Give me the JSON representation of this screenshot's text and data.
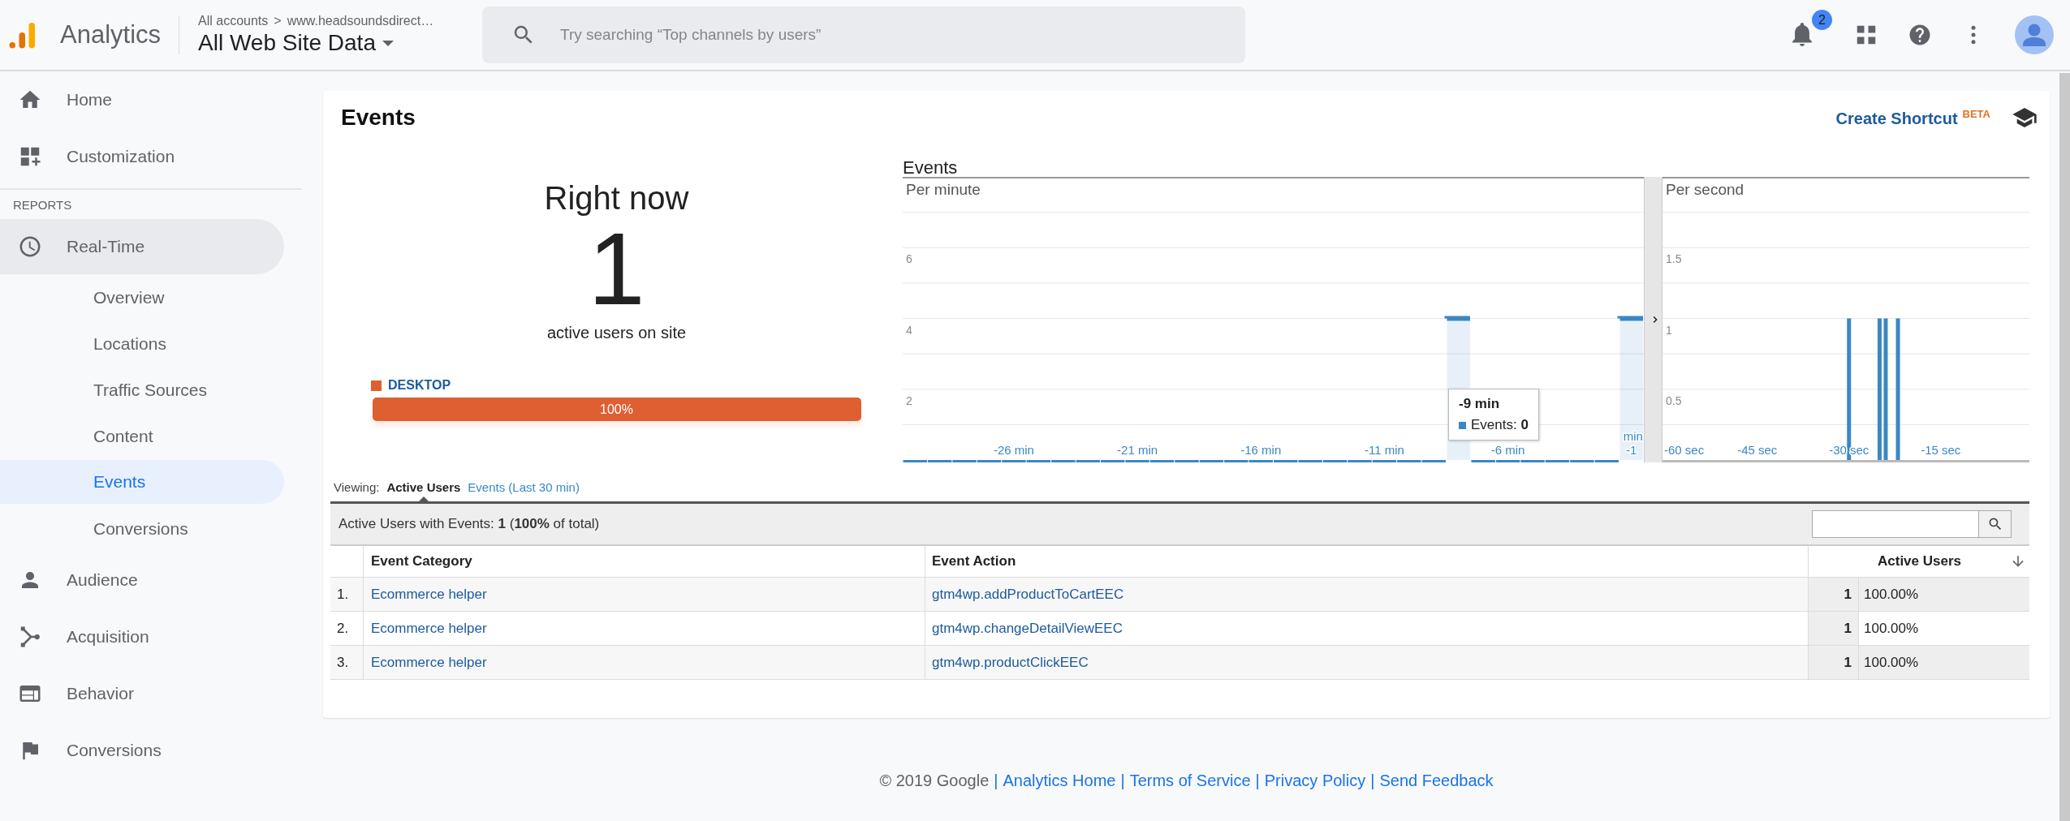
{
  "header": {
    "app_name": "Analytics",
    "breadcrumb": {
      "account": "All accounts",
      "separator": ">",
      "property": "www.headsoundsdirect…"
    },
    "view": "All Web Site Data",
    "search": {
      "placeholder": "Try searching “Top channels by users”"
    },
    "notification_count": "2"
  },
  "sidebar": {
    "items": [
      {
        "label": "Home",
        "selected": false
      },
      {
        "label": "Customization",
        "selected": false
      }
    ],
    "section_label": "REPORTS",
    "reports": [
      {
        "label": "Real-Time",
        "expanded": true,
        "children": [
          {
            "label": "Overview",
            "selected": false
          },
          {
            "label": "Locations",
            "selected": false
          },
          {
            "label": "Traffic Sources",
            "selected": false
          },
          {
            "label": "Content",
            "selected": false
          },
          {
            "label": "Events",
            "selected": true
          },
          {
            "label": "Conversions",
            "selected": false
          }
        ]
      },
      {
        "label": "Audience",
        "expanded": false
      },
      {
        "label": "Acquisition",
        "expanded": false
      },
      {
        "label": "Behavior",
        "expanded": false
      },
      {
        "label": "Conversions",
        "expanded": false
      }
    ]
  },
  "card": {
    "title": "Events",
    "shortcut": {
      "label": "Create Shortcut",
      "badge": "BETA"
    },
    "right_now": {
      "heading": "Right now",
      "count": "1",
      "caption": "active users on site",
      "devices": [
        {
          "label": "DESKTOP",
          "color": "#de5f31",
          "level": 1,
          "reading": "100%"
        }
      ]
    },
    "events_chart": {
      "title": "Events",
      "per_minute": {
        "label": "Per minute",
        "chart_data": {
          "type": "bar",
          "x": [
            -30,
            -29,
            -28,
            -27,
            -26,
            -25,
            -24,
            -23,
            -22,
            -21,
            -20,
            -19,
            -18,
            -17,
            -16,
            -15,
            -14,
            -13,
            -12,
            -11,
            -10,
            -9,
            -8,
            -7,
            -6,
            -5,
            -4,
            -3,
            -2,
            -1
          ],
          "series": [
            {
              "color": "#3b87c5",
              "values": [
                0,
                0,
                0,
                0,
                0,
                0,
                0,
                0,
                0,
                0,
                0,
                0,
                0,
                0,
                0,
                0,
                0,
                0,
                0,
                0,
                0,
                0,
                4,
                0,
                0,
                0,
                0,
                0,
                0,
                4
              ]
            }
          ],
          "xlim": [
            -30.5,
            -0.5
          ],
          "ylim": [
            0,
            8
          ],
          "grid": true,
          "yticks": [
            2,
            4,
            6
          ],
          "xticks": [
            {
              "value": -26,
              "label": "-26 min"
            },
            {
              "value": -21,
              "label": "-21 min"
            },
            {
              "value": -16,
              "label": "-16 min"
            },
            {
              "value": -11,
              "label": "-11 min"
            },
            {
              "value": -6,
              "label": "-6 min"
            },
            {
              "value": -1,
              "label": "-1 min"
            }
          ]
        },
        "tooltip": {
          "title": "-9 min",
          "text": "Events: **0**"
        }
      },
      "per_second": {
        "label": "Per second",
        "chart_data": {
          "type": "bar",
          "x": [
            -60,
            -59,
            -58,
            -57,
            -56,
            -55,
            -54,
            -53,
            -52,
            -51,
            -50,
            -49,
            -48,
            -47,
            -46,
            -45,
            -44,
            -43,
            -42,
            -41,
            -40,
            -39,
            -38,
            -37,
            -36,
            -35,
            -34,
            -33,
            -32,
            -31,
            -30,
            -29,
            -28,
            -27,
            -26,
            -25,
            -24,
            -23,
            -22,
            -21,
            -20,
            -19,
            -18,
            -17,
            -16,
            -15,
            -14,
            -13,
            -12,
            -11,
            -10,
            -9,
            -8,
            -7,
            -6,
            -5,
            -4,
            -3,
            -2,
            -1
          ],
          "series": [
            {
              "color": "#3b87c5",
              "values": [
                0,
                0,
                0,
                0,
                0,
                0,
                0,
                0,
                0,
                0,
                0,
                0,
                0,
                0,
                0,
                0,
                0,
                0,
                0,
                0,
                0,
                0,
                0,
                0,
                0,
                0,
                0,
                0,
                0,
                0,
                1,
                0,
                0,
                0,
                0,
                1,
                1,
                0,
                1,
                0,
                0,
                0,
                0,
                0,
                0,
                0,
                0,
                0,
                0,
                0,
                0,
                0,
                0,
                0,
                0,
                0,
                0,
                0,
                0,
                0
              ]
            }
          ],
          "xlim": [
            -60.5,
            -0.5
          ],
          "ylim": [
            0,
            2
          ],
          "grid": true,
          "yticks": [
            0.5,
            1,
            1.5
          ],
          "xticks": [
            {
              "value": -60,
              "label": "-60 sec"
            },
            {
              "value": -45,
              "label": "-45 sec"
            },
            {
              "value": -30,
              "label": "-30 sec"
            },
            {
              "value": -15,
              "label": "-15 sec"
            }
          ]
        }
      }
    },
    "viewing": {
      "label": "Viewing:",
      "tabs": [
        {
          "label": "Active Users",
          "selected": true
        },
        {
          "label": "Events (Last 30 min)",
          "selected": false
        }
      ]
    },
    "table": {
      "summary": "Active Users with Events: **1** (**100%** of total)",
      "columns": [
        "Event Category",
        "Event Action",
        "Active Users"
      ],
      "rows": [
        {
          "index": "1.",
          "category": "Ecommerce helper",
          "action": "gtm4wp.addProductToCartEEC",
          "users": "1",
          "share": "100.00%"
        },
        {
          "index": "2.",
          "category": "Ecommerce helper",
          "action": "gtm4wp.changeDetailViewEEC",
          "users": "1",
          "share": "100.00%"
        },
        {
          "index": "3.",
          "category": "Ecommerce helper",
          "action": "gtm4wp.productClickEEC",
          "users": "1",
          "share": "100.00%"
        }
      ]
    }
  },
  "footer": {
    "copyright": "© 2019 Google",
    "separator": "|",
    "links": [
      "Analytics Home",
      "Terms of Service",
      "Privacy Policy",
      "Send Feedback"
    ]
  }
}
